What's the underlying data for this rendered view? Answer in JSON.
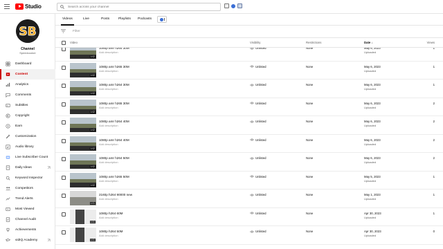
{
  "header": {
    "logo_text": "Studio",
    "search_placeholder": "Search across your channel"
  },
  "sidebar": {
    "channel_label": "Channel",
    "channel_name": "Speedcooker",
    "avatar_text": "SB",
    "items": [
      {
        "label": "Dashboard",
        "icon": "dashboard-icon",
        "active": false
      },
      {
        "label": "Content",
        "icon": "content-icon",
        "active": true
      },
      {
        "label": "Analytics",
        "icon": "analytics-icon",
        "active": false
      },
      {
        "label": "Comments",
        "icon": "comments-icon",
        "active": false
      },
      {
        "label": "Subtitles",
        "icon": "subtitles-icon",
        "active": false
      },
      {
        "label": "Copyright",
        "icon": "copyright-icon",
        "active": false
      },
      {
        "label": "Earn",
        "icon": "earn-icon",
        "active": false
      },
      {
        "label": "Customization",
        "icon": "customization-icon",
        "active": false
      },
      {
        "label": "Audio library",
        "icon": "audio-library-icon",
        "active": false
      },
      {
        "label": "Live Subscriber Count",
        "icon": "subscriber-count-icon",
        "active": false
      },
      {
        "label": "Daily Ideas",
        "icon": "daily-ideas-icon",
        "active": false,
        "external": true
      },
      {
        "label": "Keyword Inspector",
        "icon": "keyword-inspector-icon",
        "active": false
      },
      {
        "label": "Competitors",
        "icon": "competitors-icon",
        "active": false
      },
      {
        "label": "Trend Alerts",
        "icon": "trend-alerts-icon",
        "active": false
      },
      {
        "label": "Most Viewed",
        "icon": "most-viewed-icon",
        "active": false
      },
      {
        "label": "Channel Audit",
        "icon": "channel-audit-icon",
        "active": false
      },
      {
        "label": "Achievements",
        "icon": "achievements-icon",
        "active": false
      },
      {
        "label": "vidIQ Academy",
        "icon": "academy-icon",
        "active": false,
        "external": true
      }
    ]
  },
  "tabs": [
    "Videos",
    "Live",
    "Posts",
    "Playlists",
    "Podcasts"
  ],
  "filter": {
    "placeholder": "Filter"
  },
  "table": {
    "headers": {
      "video": "Video",
      "visibility": "Visibility",
      "restrictions": "Restrictions",
      "date": "Date",
      "views": "Views"
    },
    "rows": [
      {
        "title": "1080p amr h264 30M",
        "desc": "Add description",
        "duration": "1:02",
        "visibility": "Unlisted",
        "restrictions": "None",
        "date": "May 6, 2023",
        "status": "Uploaded",
        "views": "1",
        "thumb": "t1"
      },
      {
        "title": "1080p amr h265 30M",
        "desc": "Add description",
        "duration": "1:02",
        "visibility": "Unlisted",
        "restrictions": "None",
        "date": "May 6, 2023",
        "status": "Uploaded",
        "views": "1",
        "thumb": "t1"
      },
      {
        "title": "1080p amr h264 30M",
        "desc": "Add description",
        "duration": "1:02",
        "visibility": "Unlisted",
        "restrictions": "None",
        "date": "May 6, 2023",
        "status": "Uploaded",
        "views": "1",
        "thumb": "t1"
      },
      {
        "title": "1080p amr h265 30M",
        "desc": "Add description",
        "duration": "1:02",
        "visibility": "Unlisted",
        "restrictions": "None",
        "date": "May 6, 2023",
        "status": "Uploaded",
        "views": "2",
        "thumb": "t1"
      },
      {
        "title": "1080p amr h264 40M",
        "desc": "Add description",
        "duration": "1:02",
        "visibility": "Unlisted",
        "restrictions": "None",
        "date": "May 6, 2023",
        "status": "Uploaded",
        "views": "2",
        "thumb": "t1"
      },
      {
        "title": "1080p amr h264 40M",
        "desc": "Add description",
        "duration": "1:02",
        "visibility": "Unlisted",
        "restrictions": "None",
        "date": "May 6, 2023",
        "status": "Uploaded",
        "views": "2",
        "thumb": "t1"
      },
      {
        "title": "1080p amr h264 50M",
        "desc": "Add description",
        "duration": "1:02",
        "visibility": "Unlisted",
        "restrictions": "None",
        "date": "May 6, 2023",
        "status": "Uploaded",
        "views": "2",
        "thumb": "t1"
      },
      {
        "title": "1080p amr h265 50M",
        "desc": "Add description",
        "duration": "1:02",
        "visibility": "Unlisted",
        "restrictions": "None",
        "date": "May 5, 2023",
        "status": "Uploaded",
        "views": "1",
        "thumb": "t1"
      },
      {
        "title": "2160p h264 90000 new",
        "desc": "Add description",
        "duration": "1:01",
        "visibility": "Unlisted",
        "restrictions": "None",
        "date": "May 1, 2023",
        "status": "Uploaded",
        "views": "1",
        "thumb": "t2"
      },
      {
        "title": "1080p h264 60M",
        "desc": "Add description",
        "duration": "1:01",
        "visibility": "Unlisted",
        "restrictions": "None",
        "date": "Apr 30, 2023",
        "status": "Uploaded",
        "views": "1",
        "thumb": "t3"
      },
      {
        "title": "1080p h264 50M",
        "desc": "Add description",
        "duration": "1:01",
        "visibility": "Unlisted",
        "restrictions": "None",
        "date": "Apr 30, 2023",
        "status": "Uploaded",
        "views": "0",
        "thumb": "t3"
      }
    ]
  }
}
